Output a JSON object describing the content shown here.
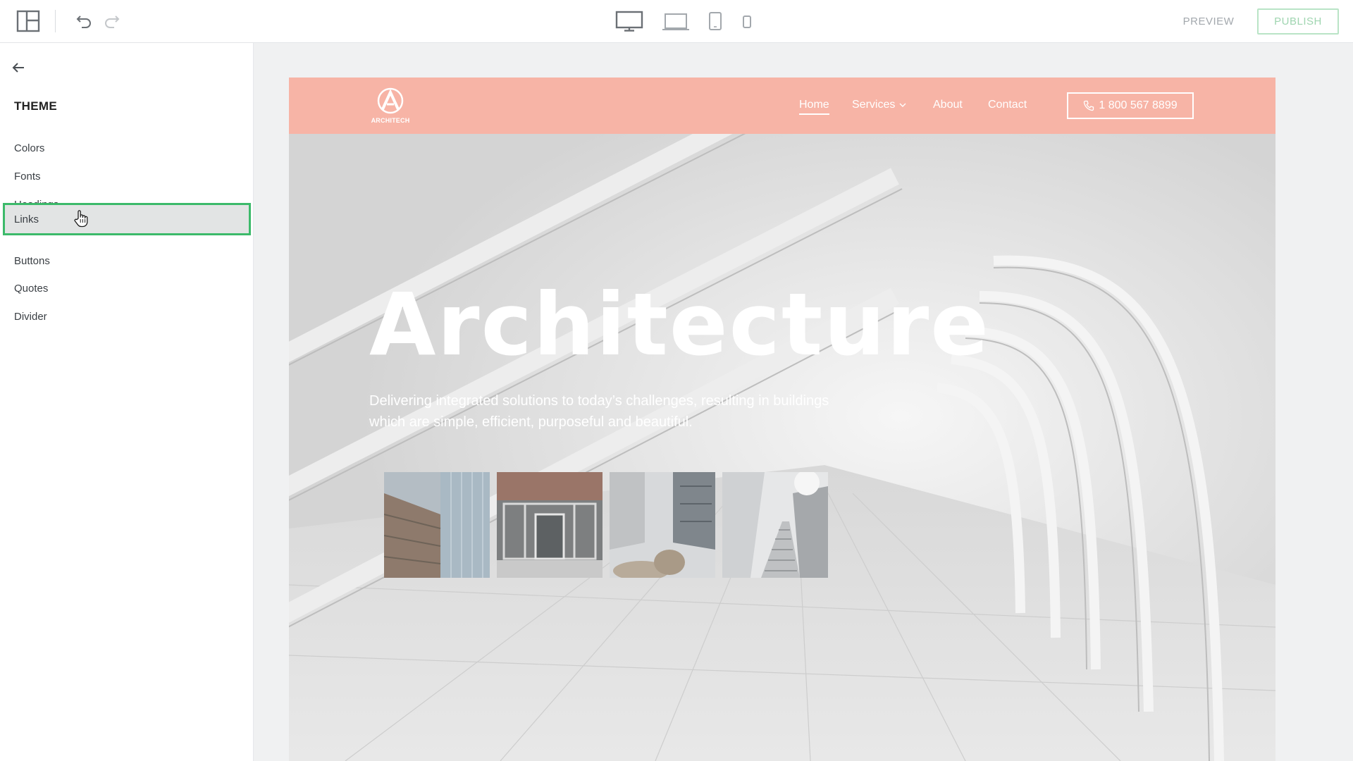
{
  "toolbar": {
    "preview_label": "PREVIEW",
    "publish_label": "PUBLISH",
    "icons": [
      "layout-icon",
      "undo-icon",
      "redo-icon",
      "desktop-icon",
      "laptop-icon",
      "tablet-icon",
      "mobile-icon"
    ]
  },
  "sidebar": {
    "title": "THEME",
    "items": [
      {
        "label": "Colors"
      },
      {
        "label": "Fonts"
      },
      {
        "label": "Headings"
      },
      {
        "label": "Links",
        "active": true
      },
      {
        "label": "Buttons"
      },
      {
        "label": "Quotes"
      },
      {
        "label": "Divider"
      }
    ]
  },
  "site": {
    "logo_text": "ARCHITECH",
    "nav": [
      {
        "label": "Home"
      },
      {
        "label": "Services"
      },
      {
        "label": "About"
      },
      {
        "label": "Contact"
      }
    ],
    "phone": "1 800 567 8899",
    "hero_title": "Architecture",
    "hero_subtitle": "Delivering integrated solutions to today’s challenges, resulting in buildings which are simple, efficient, purposeful and beautiful."
  },
  "colors": {
    "nav_bg": "#f7b4a6",
    "accent_green": "#3cba6a",
    "publish_border": "#b9e4c6"
  }
}
